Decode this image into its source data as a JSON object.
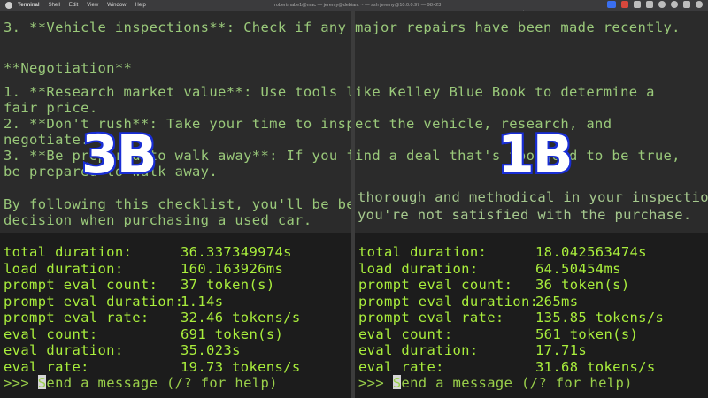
{
  "menubar": {
    "app_name": "Terminal",
    "items": [
      "Shell",
      "Edit",
      "View",
      "Window",
      "Help"
    ],
    "window_title": "robertmabe1@mac — jeremy@debian: ~ — ssh jeremy@10.0.0.97 — 98×23"
  },
  "top_lines": [
    "3. **Vehicle inspections**: Check if any major repairs have been made recently.",
    "",
    "**Negotiation**",
    "",
    "1. **Research market value**: Use tools like Kelley Blue Book to determine a",
    "fair price.",
    "2. **Don't rush**: Take your time to inspect the vehicle, research, and",
    "negotiate.",
    "3. **Be prepared to walk away**: If you find a deal that's too good to be true,",
    "be prepared to walk away.",
    "",
    "By following this checklist, you'll be better",
    "decision when purchasing a used car."
  ],
  "right_tail_lines": [
    "thorough and methodical in your inspections",
    "you're not satisfied with the purchase."
  ],
  "left_pane": {
    "label": "3B",
    "stats": [
      {
        "key": "total duration:",
        "value": "36.337349974s"
      },
      {
        "key": "load duration:",
        "value": "160.163926ms"
      },
      {
        "key": "prompt eval count:",
        "value": "37 token(s)"
      },
      {
        "key": "prompt eval duration:",
        "value": "1.14s"
      },
      {
        "key": "prompt eval rate:",
        "value": "32.46 tokens/s"
      },
      {
        "key": "eval count:",
        "value": "691 token(s)"
      },
      {
        "key": "eval duration:",
        "value": "35.023s"
      },
      {
        "key": "eval rate:",
        "value": "19.73 tokens/s"
      }
    ],
    "prompt": ">>> ",
    "prompt_placeholder": "Send a message (/? for help)"
  },
  "right_pane": {
    "label": "1B",
    "stats": [
      {
        "key": "total duration:",
        "value": "18.042563474s"
      },
      {
        "key": "load duration:",
        "value": "64.50454ms"
      },
      {
        "key": "prompt eval count:",
        "value": "36 token(s)"
      },
      {
        "key": "prompt eval duration:",
        "value": "265ms"
      },
      {
        "key": "prompt eval rate:",
        "value": "135.85 tokens/s"
      },
      {
        "key": "eval count:",
        "value": "561 token(s)"
      },
      {
        "key": "eval duration:",
        "value": "17.71s"
      },
      {
        "key": "eval rate:",
        "value": "31.68 tokens/s"
      }
    ],
    "prompt": ">>> ",
    "prompt_placeholder": "Send a message (/? for help)"
  },
  "colors": {
    "stat_text": "#a9ee3c",
    "output_text": "#9ac97a",
    "label_fill": "#ffffff",
    "label_stroke": "#1a2fd6"
  }
}
